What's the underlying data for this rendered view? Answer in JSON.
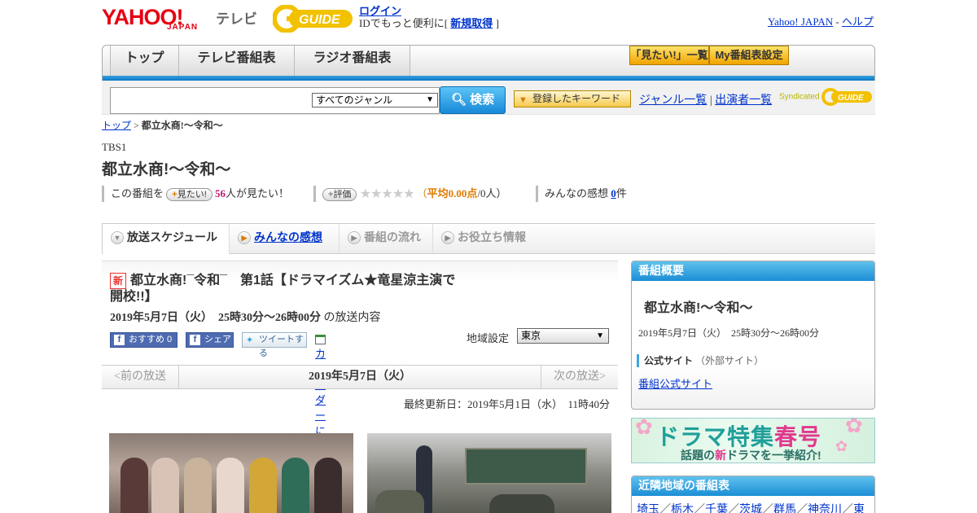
{
  "header": {
    "logo": "YAHOO!",
    "logo_sub": "JAPAN",
    "tv_label": "テレビ",
    "guide_logo": "GUIDE",
    "login_link": "ログイン",
    "login_text": "IDでもっと便利に[",
    "signup_link": "新規取得",
    "signup_close": "]",
    "yahoo_japan_link": "Yahoo! JAPAN",
    "separator": "-",
    "help_link": "ヘルプ"
  },
  "nav": {
    "tabs": [
      "トップ",
      "テレビ番組表",
      "ラジオ番組表"
    ],
    "watch_list_btn": "「見たい!」一覧",
    "my_schedule_btn": "My番組表設定"
  },
  "search": {
    "genre_value": "すべてのジャンル",
    "search_btn": "検索",
    "keyword_btn": "登録したキーワード",
    "genre_list_link": "ジャンル一覧",
    "divider": "|",
    "cast_list_link": "出演者一覧",
    "syndicated": "Syndicated"
  },
  "breadcrumb": {
    "home": "トップ",
    "sep": ">",
    "current": "都立水商!～令和～"
  },
  "program": {
    "station": "TBS1",
    "title": "都立水商!～令和～",
    "want_prefix": "この番組を",
    "want_btn": "見たい!",
    "want_count": "56",
    "want_suffix": "人が見たい！",
    "rate_btn": "評価",
    "stars": "★★★★★",
    "avg_open": "（",
    "avg_label": "平均0.00点",
    "avg_people": "/0人）",
    "impressions_prefix": "みんなの感想",
    "impressions_count": "0",
    "impressions_suffix": "件"
  },
  "subtabs": [
    "放送スケジュール",
    "みんなの感想",
    "番組の流れ",
    "お役立ち情報"
  ],
  "episode": {
    "new_badge": "新",
    "title": "都立水商!¯令和¯　第1話【ドラマイズム★竜星涼主演で開校!!】",
    "date": "2019年5月7日（火）　25時30分～26時00分",
    "date_suffix": "の放送内容",
    "fb_recommend": "おすすめ 0",
    "fb_share": "シェア",
    "tweet": "ツイートする",
    "calendar": "カレンダーに登録",
    "region_label": "地域設定",
    "region_value": "東京"
  },
  "pager": {
    "prev": "<前の放送",
    "current": "2019年5月7日（火）",
    "next": "次の放送>"
  },
  "updated": "最終更新日：2019年5月1日（水）　11時40分",
  "sidebar": {
    "overview_header": "番組概要",
    "overview_title": "都立水商!～令和～",
    "overview_date": "2019年5月7日（火）　25時30分～26時00分",
    "official_label": "公式サイト",
    "official_note": "（外部サイト）",
    "official_link": "番組公式サイト",
    "banner_main": "ドラマ特集",
    "banner_spring": "春号",
    "banner_sub_a": "話題の",
    "banner_sub_new": "新",
    "banner_sub_b": "ドラマを一挙紹介!",
    "nearby_header": "近隣地域の番組表",
    "nearby_links": [
      "埼玉",
      "栃木",
      "千葉",
      "茨城",
      "群馬",
      "神奈川",
      "東"
    ]
  },
  "colors": {
    "accent_blue": "#1c8ed6",
    "link": "#0033cc",
    "orange": "#e07b00",
    "brand_red": "#e60012"
  }
}
